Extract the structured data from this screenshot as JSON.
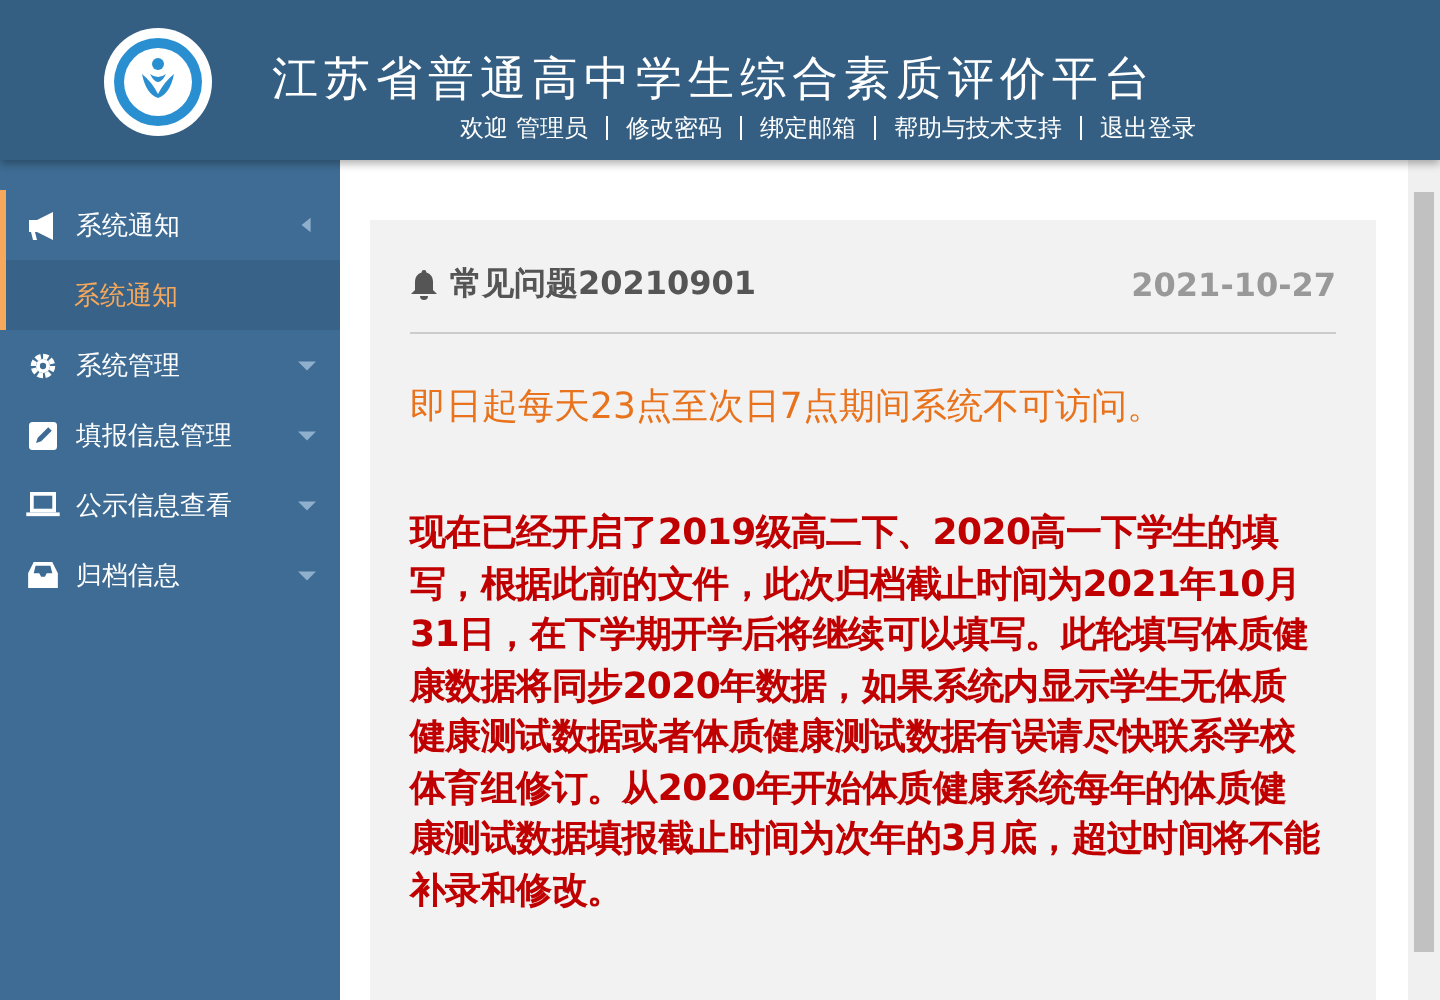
{
  "header": {
    "title": "江苏省普通高中学生综合素质评价平台",
    "links": [
      "欢迎 管理员",
      "修改密码",
      "绑定邮箱",
      "帮助与技术支持",
      "退出登录"
    ]
  },
  "sidebar": {
    "items": [
      {
        "label": "系统通知",
        "expanded": true,
        "children": [
          {
            "label": "系统通知",
            "selected": true
          }
        ]
      },
      {
        "label": "系统管理",
        "expanded": false
      },
      {
        "label": "填报信息管理",
        "expanded": false
      },
      {
        "label": "公示信息查看",
        "expanded": false
      },
      {
        "label": "归档信息",
        "expanded": false
      }
    ]
  },
  "notice": {
    "title": "常见问题20210901",
    "date": "2021-10-27",
    "paragraphs": [
      {
        "kind": "orange",
        "text": "即日起每天23点至次日7点期间系统不可访问。"
      },
      {
        "kind": "red",
        "text": "现在已经开启了2019级高二下、2020高一下学生的填写，根据此前的文件，此次归档截止时间为2021年10月31日，在下学期开学后将继续可以填写。此轮填写体质健康数据将同步2020年数据，如果系统内显示学生无体质健康测试数据或者体质健康测试数据有误请尽快联系学校体育组修订。从2020年开始体质健康系统每年的体质健康测试数据填报截止时间为次年的3月底，超过时间将不能补录和修改。"
      }
    ]
  }
}
